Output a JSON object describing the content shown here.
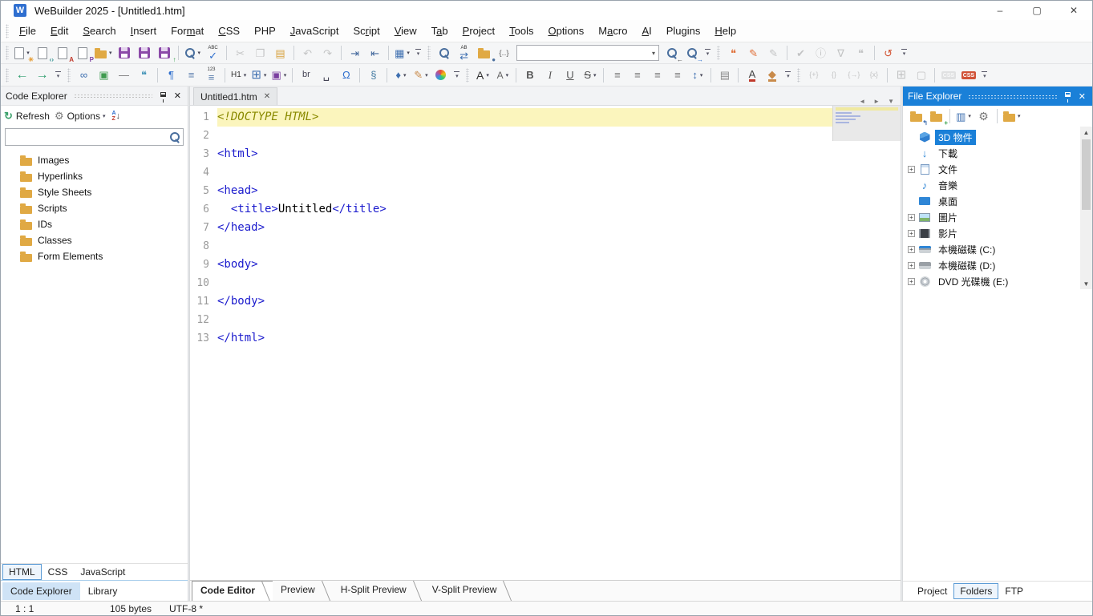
{
  "glyphs": {
    "close": "✕",
    "minimize": "–",
    "maximize": "▢",
    "caret": "▾",
    "tab_prev": "◄",
    "tab_next": "►",
    "tab_menu": "▼",
    "scroll_up": "▲",
    "scroll_down": "▼",
    "expand": "+"
  },
  "window": {
    "title": "WeBuilder 2025 - [Untitled1.htm]",
    "app_badge": "W"
  },
  "menu": {
    "items": [
      {
        "t": "File",
        "u": 0
      },
      {
        "t": "Edit",
        "u": 0
      },
      {
        "t": "Search",
        "u": 0
      },
      {
        "t": "Insert",
        "u": 0
      },
      {
        "t": "Format",
        "u": 3
      },
      {
        "t": "CSS",
        "u": 0
      },
      {
        "t": "PHP",
        "u": -1
      },
      {
        "t": "JavaScript",
        "u": 0
      },
      {
        "t": "Script",
        "u": 2
      },
      {
        "t": "View",
        "u": 0
      },
      {
        "t": "Tab",
        "u": 1
      },
      {
        "t": "Project",
        "u": 0
      },
      {
        "t": "Tools",
        "u": 0
      },
      {
        "t": "Options",
        "u": 0
      },
      {
        "t": "Macro",
        "u": 1
      },
      {
        "t": "AI",
        "u": 0
      },
      {
        "t": "Plugins",
        "u": -1
      },
      {
        "t": "Help",
        "u": 0
      }
    ]
  },
  "toolbar_main": {
    "items": [
      {
        "grip": true
      },
      {
        "n": "new-document-button",
        "icon": "page",
        "badge": "✳",
        "bc": "#e59a2f",
        "dd": true
      },
      {
        "n": "new-html-document-button",
        "icon": "page",
        "badge": "‹›",
        "bc": "#2e8f8f"
      },
      {
        "n": "new-stylesheet-button",
        "icon": "page",
        "badge": "A",
        "bc": "#c0392b"
      },
      {
        "n": "new-php-document-button",
        "icon": "page",
        "badge": "P",
        "bc": "#7b3fa0"
      },
      {
        "n": "open-file-button",
        "icon": "folder",
        "dd": true
      },
      {
        "n": "save-button",
        "icon": "floppy"
      },
      {
        "n": "save-all-button",
        "icon": "floppy"
      },
      {
        "n": "save-upload-button",
        "icon": "floppy",
        "badge": "↑",
        "bc": "#2f9e44"
      },
      {
        "sep": true
      },
      {
        "n": "search-button",
        "icon": "lens",
        "dd": true
      },
      {
        "n": "spell-check-button",
        "g": "✓",
        "c": "#2f6fce",
        "top": "ABC"
      },
      {
        "sep": true
      },
      {
        "n": "cut-button",
        "g": "✂",
        "c": "#666",
        "dis": true
      },
      {
        "n": "copy-button",
        "g": "❐",
        "c": "#666",
        "dis": true
      },
      {
        "n": "paste-button",
        "g": "▤",
        "c": "#d8a13f"
      },
      {
        "sep": true
      },
      {
        "n": "undo-button",
        "g": "↶",
        "c": "#666",
        "dis": true
      },
      {
        "n": "redo-button",
        "g": "↷",
        "c": "#666",
        "dis": true
      },
      {
        "sep": true
      },
      {
        "n": "indent-button",
        "g": "⇥",
        "c": "#44699d"
      },
      {
        "n": "outdent-button",
        "g": "⇤",
        "c": "#44699d"
      },
      {
        "sep": true
      },
      {
        "n": "panel-layout-button",
        "g": "▦",
        "c": "#3e6fb0",
        "dd": true
      },
      {
        "ovf": true
      },
      {
        "grip": true
      },
      {
        "n": "find-button",
        "icon": "lens"
      },
      {
        "n": "replace-button",
        "g": "⇄",
        "c": "#3e6fb0",
        "top": "AB"
      },
      {
        "n": "find-in-files-button",
        "icon": "folder",
        "badge": "●",
        "bc": "#4a6f9e"
      },
      {
        "n": "code-snippets-button",
        "g": "{‥}",
        "c": "#555",
        "f": 9
      },
      {
        "combo": true,
        "n": "search-term-combobox",
        "value": ""
      },
      {
        "n": "find-previous-button",
        "icon": "lens",
        "badge": "←",
        "bc": "#444"
      },
      {
        "n": "find-next-button",
        "icon": "lens",
        "badge": "→",
        "bc": "#2f6fce"
      },
      {
        "ovf": true
      },
      {
        "grip": true
      },
      {
        "n": "ai-chat-button",
        "g": "❝",
        "c": "#e0703a"
      },
      {
        "n": "script-wizard-button",
        "g": "✎",
        "c": "#e0703a"
      },
      {
        "n": "edit-pencil-button",
        "g": "✎",
        "c": "#666",
        "dis": true
      },
      {
        "sep": true
      },
      {
        "n": "validate-button",
        "g": "✔",
        "c": "#666",
        "dis": true
      },
      {
        "n": "info-button",
        "g": "ⓘ",
        "c": "#666",
        "dis": true
      },
      {
        "n": "filter-button",
        "g": "∇",
        "c": "#666",
        "dis": true
      },
      {
        "n": "comment-button",
        "g": "❝",
        "c": "#666",
        "dis": true
      },
      {
        "sep": true
      },
      {
        "n": "local-history-button",
        "g": "↺",
        "c": "#d2502f"
      },
      {
        "ovf": true
      }
    ]
  },
  "toolbar_format": {
    "items": [
      {
        "grip": true
      },
      {
        "n": "navigate-back-button",
        "g": "←",
        "c": "#2f9e6e",
        "f": 16
      },
      {
        "n": "navigate-forward-button",
        "g": "→",
        "c": "#2f9e6e",
        "f": 16
      },
      {
        "ovf": true
      },
      {
        "grip": true
      },
      {
        "n": "insert-link-button",
        "g": "∞",
        "c": "#3e6fb0"
      },
      {
        "n": "insert-image-button",
        "g": "▣",
        "c": "#3f9b4f"
      },
      {
        "n": "insert-hr-button",
        "g": "—",
        "c": "#777"
      },
      {
        "n": "insert-comment-button",
        "g": "❝",
        "c": "#3b8fb5"
      },
      {
        "sep": true
      },
      {
        "n": "paragraph-button",
        "g": "¶",
        "c": "#2f6fce"
      },
      {
        "n": "bullet-list-button",
        "g": "≡",
        "c": "#5b7fae"
      },
      {
        "n": "numbered-list-button",
        "g": "≡",
        "c": "#5b7fae",
        "top": "123"
      },
      {
        "sep": true
      },
      {
        "n": "heading-button",
        "g": "H1",
        "c": "#333",
        "f": 10,
        "dd": true
      },
      {
        "n": "insert-table-button",
        "g": "⊞",
        "c": "#3e6fb0",
        "f": 15,
        "dd": true
      },
      {
        "n": "insert-form-button",
        "g": "▣",
        "c": "#7b3fa0",
        "dd": true
      },
      {
        "sep": true
      },
      {
        "n": "insert-br-button",
        "g": "br",
        "c": "#445",
        "f": 11
      },
      {
        "n": "insert-nbsp-button",
        "g": "␣",
        "c": "#445"
      },
      {
        "n": "special-chars-button",
        "g": "Ω",
        "c": "#2f6fce"
      },
      {
        "sep": true
      },
      {
        "n": "script-block-button",
        "g": "§",
        "c": "#4a7fa5"
      },
      {
        "sep": true
      },
      {
        "n": "tag-button",
        "g": "♦",
        "c": "#3e6fb0",
        "dd": true
      },
      {
        "n": "format-painter-button",
        "g": "✎",
        "c": "#c98b4b",
        "dd": true
      },
      {
        "n": "color-picker-button",
        "icon": "colorwheel"
      },
      {
        "ovf": true
      },
      {
        "grip": true
      },
      {
        "n": "increase-font-button",
        "g": "A",
        "c": "#333",
        "f": 14,
        "dd": true
      },
      {
        "n": "font-style-button",
        "g": "A",
        "c": "#666",
        "f": 12,
        "dd": true
      },
      {
        "sep": true
      },
      {
        "n": "bold-button",
        "g": "B",
        "c": "#555",
        "bold": true
      },
      {
        "n": "italic-button",
        "g": "I",
        "c": "#555",
        "ital": true
      },
      {
        "n": "underline-button",
        "g": "U",
        "c": "#555",
        "und": true
      },
      {
        "n": "strikethrough-button",
        "g": "S",
        "c": "#555",
        "strike": true,
        "dd": true
      },
      {
        "sep": true
      },
      {
        "n": "align-left-button",
        "g": "≡",
        "c": "#777"
      },
      {
        "n": "align-center-button",
        "g": "≡",
        "c": "#777"
      },
      {
        "n": "align-right-button",
        "g": "≡",
        "c": "#777"
      },
      {
        "n": "align-justify-button",
        "g": "≡",
        "c": "#777"
      },
      {
        "n": "line-spacing-button",
        "g": "↕",
        "c": "#3e6fb0",
        "dd": true
      },
      {
        "sep": true
      },
      {
        "n": "paragraph-format-button",
        "g": "▤",
        "c": "#888"
      },
      {
        "sep": true
      },
      {
        "n": "font-color-button",
        "g": "A",
        "c": "#444",
        "ubar": "#c0392b"
      },
      {
        "n": "fill-color-button",
        "g": "◆",
        "c": "#c98b4b",
        "ubar": "#c98b4b"
      },
      {
        "ovf": true
      },
      {
        "grip": true
      },
      {
        "n": "insert-snippet-button",
        "g": "{+}",
        "c": "#666",
        "f": 9,
        "dis": true
      },
      {
        "n": "braces-button",
        "g": "{}",
        "c": "#666",
        "f": 9,
        "dis": true
      },
      {
        "n": "goto-brace-button",
        "g": "{→}",
        "c": "#666",
        "f": 9,
        "dis": true
      },
      {
        "n": "clear-braces-button",
        "g": "{x}",
        "c": "#666",
        "f": 9,
        "dis": true
      },
      {
        "sep": true
      },
      {
        "n": "table-layout-button",
        "g": "⊞",
        "c": "#666",
        "f": 15,
        "dis": true
      },
      {
        "n": "div-layout-button",
        "g": "▢",
        "c": "#666",
        "dis": true
      },
      {
        "sep": true
      },
      {
        "n": "css-check-disabled-button",
        "icon": "cssbadge-gray",
        "dis": true
      },
      {
        "n": "css-check-button",
        "icon": "cssbadge"
      },
      {
        "ovf": true
      }
    ]
  },
  "code_explorer": {
    "title": "Code Explorer",
    "refresh_label": "Refresh",
    "refresh_glyph": "↻",
    "options_label": "Options",
    "options_glyph": "⚙",
    "sort_a": "A",
    "sort_z": "Z",
    "sort_arrow": "↓",
    "search_value": "",
    "search_placeholder": "",
    "tree": [
      "Images",
      "Hyperlinks",
      "Style Sheets",
      "Scripts",
      "IDs",
      "Classes",
      "Form Elements"
    ]
  },
  "editor": {
    "tab_label": "Untitled1.htm",
    "lines": [
      {
        "n": "1",
        "hl": true,
        "seg": [
          {
            "t": "<!DOCTYPE HTML>",
            "c": "doctype"
          }
        ]
      },
      {
        "n": "2",
        "seg": []
      },
      {
        "n": "3",
        "seg": [
          {
            "t": "<html>",
            "c": "tag"
          }
        ]
      },
      {
        "n": "4",
        "seg": []
      },
      {
        "n": "5",
        "seg": [
          {
            "t": "<head>",
            "c": "tag"
          }
        ]
      },
      {
        "n": "6",
        "seg": [
          {
            "t": "  ",
            "c": "plain"
          },
          {
            "t": "<title>",
            "c": "tag"
          },
          {
            "t": "Untitled",
            "c": "plain"
          },
          {
            "t": "</title>",
            "c": "tag"
          }
        ]
      },
      {
        "n": "7",
        "seg": [
          {
            "t": "</head>",
            "c": "tag"
          }
        ]
      },
      {
        "n": "8",
        "seg": []
      },
      {
        "n": "9",
        "seg": [
          {
            "t": "<body>",
            "c": "tag"
          }
        ]
      },
      {
        "n": "10",
        "seg": []
      },
      {
        "n": "11",
        "seg": [
          {
            "t": "</body>",
            "c": "tag"
          }
        ]
      },
      {
        "n": "12",
        "seg": []
      },
      {
        "n": "13",
        "seg": [
          {
            "t": "</html>",
            "c": "tag"
          }
        ]
      }
    ]
  },
  "file_explorer": {
    "title": "File Explorer",
    "toolbar": [
      {
        "n": "parent-folder-button",
        "icon": "folder",
        "badge": "↰",
        "bc": "#3e6fb0"
      },
      {
        "n": "new-folder-button",
        "icon": "folder",
        "badge": "+",
        "bc": "#2f9e44"
      },
      {
        "sep": true
      },
      {
        "n": "view-mode-button",
        "g": "▥",
        "c": "#3e6fb0",
        "dd": true
      },
      {
        "n": "settings-button",
        "g": "⚙",
        "c": "#777",
        "f": 14
      },
      {
        "sep": true
      },
      {
        "n": "folders-button",
        "icon": "folder",
        "dd": true
      }
    ],
    "tree": [
      {
        "label": "3D 物件",
        "icon": "cube",
        "sel": true
      },
      {
        "label": "下載",
        "icon": "download"
      },
      {
        "label": "文件",
        "icon": "document",
        "exp": true
      },
      {
        "label": "音樂",
        "icon": "music"
      },
      {
        "label": "桌面",
        "icon": "desktop"
      },
      {
        "label": "圖片",
        "icon": "pictures",
        "exp": true
      },
      {
        "label": "影片",
        "icon": "videos",
        "exp": true
      },
      {
        "label": "本機磁碟 (C:)",
        "icon": "disk-c",
        "exp": true
      },
      {
        "label": "本機磁碟 (D:)",
        "icon": "disk",
        "exp": true
      },
      {
        "label": "DVD 光碟機 (E:)",
        "icon": "dvd",
        "exp": true
      }
    ]
  },
  "panel_tabs": {
    "doc_types": [
      {
        "label": "HTML",
        "active": true
      },
      {
        "label": "CSS"
      },
      {
        "label": "JavaScript"
      }
    ],
    "left_panels": [
      {
        "label": "Code Explorer",
        "active": true
      },
      {
        "label": "Library"
      }
    ],
    "editor_views": [
      {
        "label": "Code Editor",
        "active": true
      },
      {
        "label": "Preview"
      },
      {
        "label": "H-Split Preview"
      },
      {
        "label": "V-Split Preview"
      }
    ],
    "right_panels": [
      {
        "label": "Project"
      },
      {
        "label": "Folders",
        "active": true
      },
      {
        "label": "FTP"
      }
    ]
  },
  "status_bar": {
    "cursor": "1 : 1",
    "size": "105 bytes",
    "encoding": "UTF-8 *"
  }
}
